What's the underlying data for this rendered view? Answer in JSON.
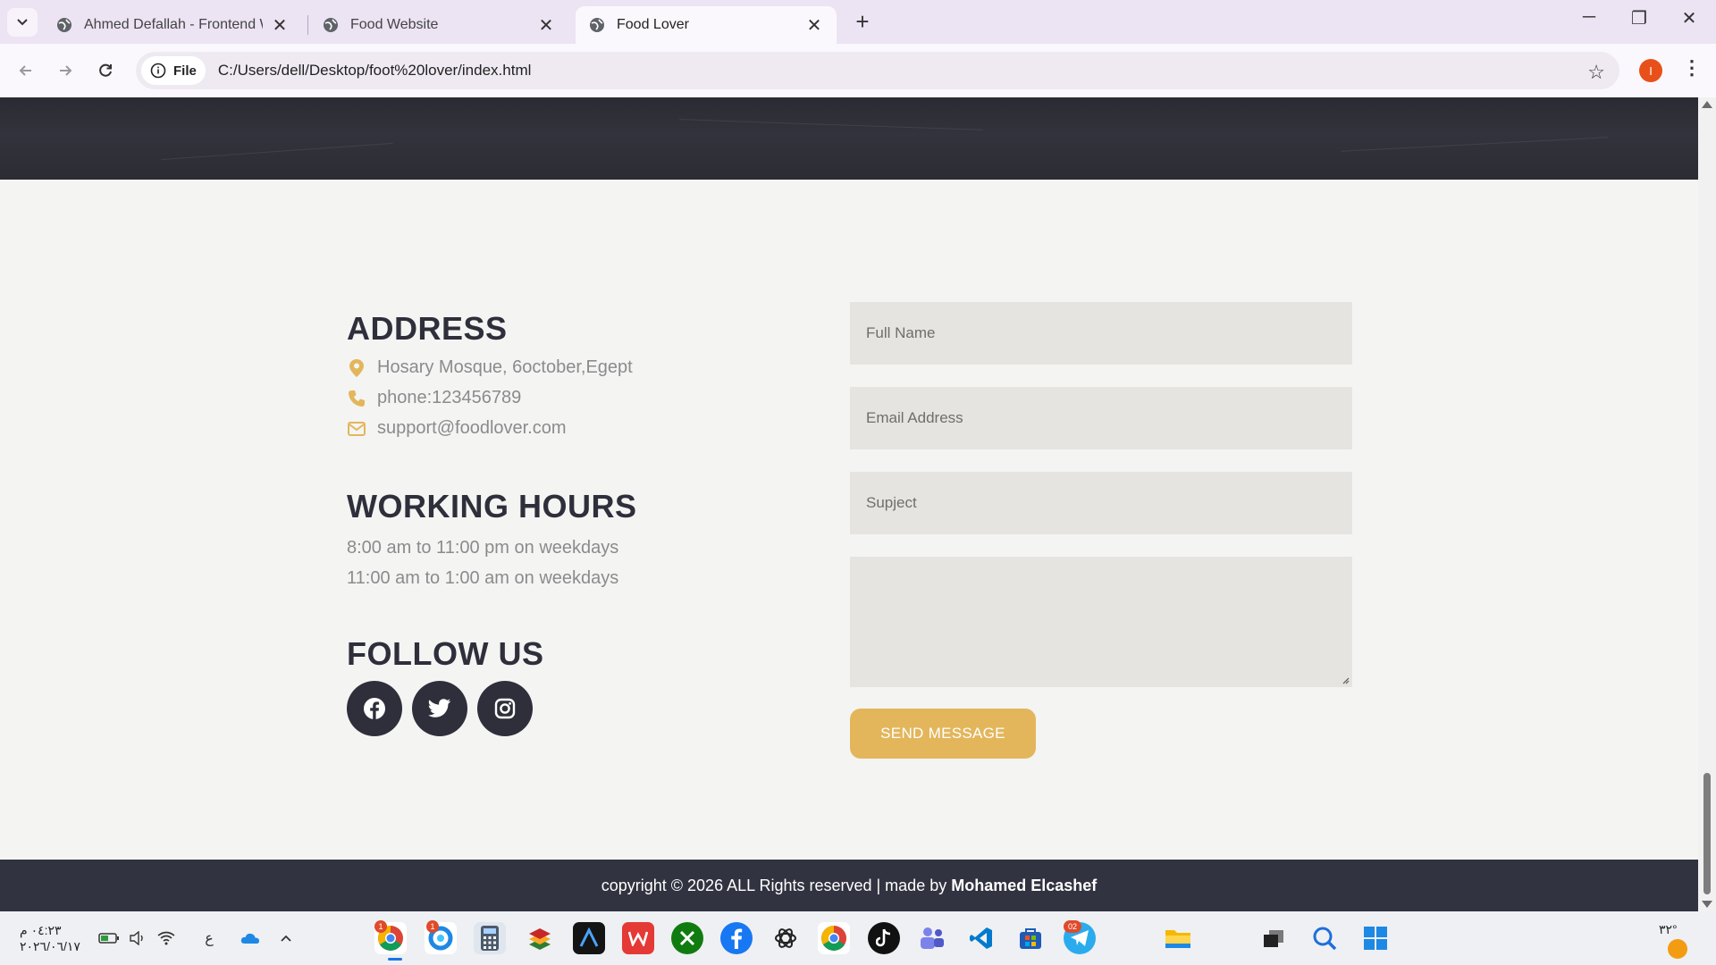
{
  "browser": {
    "tabs": [
      {
        "title": "Ahmed Defallah - Frontend We"
      },
      {
        "title": "Food Website"
      },
      {
        "title": "Food Lover"
      }
    ],
    "file_chip": "File",
    "url": "C:/Users/dell/Desktop/foot%20lover/index.html",
    "profile_initial": "I"
  },
  "contact": {
    "address_title": "ADDRESS",
    "address": "Hosary Mosque, 6october,Egept",
    "phone": "phone:123456789",
    "email": "support@foodlover.com",
    "hours_title": "WORKING HOURS",
    "hours": [
      "8:00 am to 11:00 pm on weekdays",
      "11:00 am to 1:00 am on weekdays"
    ],
    "follow_title": "FOLLOW US"
  },
  "form": {
    "full_name_placeholder": "Full Name",
    "email_placeholder": "Email Address",
    "subject_placeholder": "Supject",
    "send_label": "SEND MESSAGE"
  },
  "footer": {
    "text": "copyright © 2026 ALL Rights reserved | made by",
    "author": "Mohamed Elcashef"
  },
  "taskbar": {
    "time": "٠٤:٢٣ م",
    "date": "٢٠٢٦/٠٦/١٧",
    "language": "ع",
    "weather": "٣٢°",
    "notification_badges": [
      "1",
      "1",
      "02"
    ]
  },
  "colors": {
    "accent": "#e3b65b",
    "dark": "#2f2f3b",
    "footer_bg": "#323340",
    "page_bg": "#f4f4f3",
    "field_bg": "#e6e4e0"
  }
}
